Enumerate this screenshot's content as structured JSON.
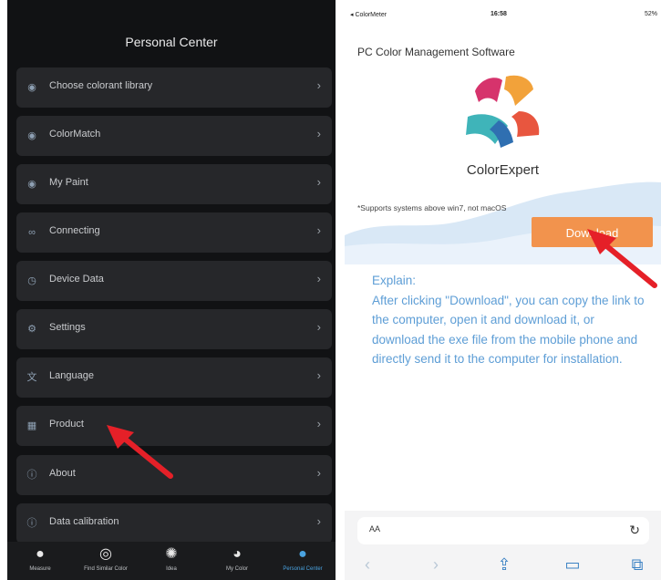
{
  "left_screen": {
    "title": "Personal Center",
    "menu": [
      {
        "label": "Choose colorant library",
        "icon": "palette-icon"
      },
      {
        "label": "ColorMatch",
        "icon": "palette-icon"
      },
      {
        "label": "My Paint",
        "icon": "palette-icon"
      },
      {
        "label": "Connecting",
        "icon": "link-icon"
      },
      {
        "label": "Device Data",
        "icon": "clock-icon"
      },
      {
        "label": "Settings",
        "icon": "gear-icon"
      },
      {
        "label": "Language",
        "icon": "translate-icon"
      },
      {
        "label": "Product",
        "icon": "grid-icon"
      },
      {
        "label": "About",
        "icon": "info-icon"
      },
      {
        "label": "Data calibration",
        "icon": "info-icon"
      }
    ],
    "tabs": [
      {
        "label": "Measure",
        "icon": "palette-icon",
        "active": false
      },
      {
        "label": "Find Similar Color",
        "icon": "compass-icon",
        "active": false
      },
      {
        "label": "Idea",
        "icon": "lightbulb-icon",
        "active": false
      },
      {
        "label": "My Color",
        "icon": "pie-chart-icon",
        "active": false
      },
      {
        "label": "Personal Center",
        "icon": "person-icon",
        "active": true
      }
    ]
  },
  "right_screen": {
    "status": {
      "carrier": "◂ ColorMeter",
      "time": "16:58",
      "battery": "52%"
    },
    "page_title": "PC Color Management Software",
    "brand": "ColorExpert",
    "support_note": "*Supports systems above win7, not macOS",
    "download_label": "Download",
    "explain_heading": "Explain:",
    "explain_body": "After clicking \"Download\", you can copy the link to the computer, open it and download it, or download the exe file from the mobile phone and directly send it to the computer for installation.",
    "url_aa": "AA",
    "colors": {
      "accent": "#f2934d",
      "explain_text": "#5e9ed6",
      "ios_blue": "#3b82c4"
    }
  }
}
